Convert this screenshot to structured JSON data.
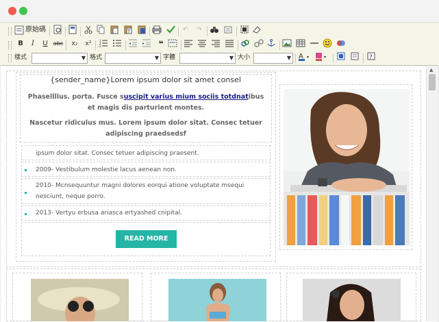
{
  "window": {
    "controls": [
      "close",
      "minimize"
    ],
    "colors": {
      "close": "#ee5c53",
      "minimize": "#3fc64c"
    }
  },
  "toolbar": {
    "source_label": "原始碼",
    "style_label": "樣式",
    "format_label": "格式",
    "font_label": "字體",
    "size_label": "大小",
    "style_value": "",
    "format_value": "",
    "font_value": "",
    "size_value": ""
  },
  "email": {
    "sender_line": "{sender_name}Lorem ipsum dolor sit amet consel",
    "para1_start": "Phasellllus. porta. Fusce s",
    "para1_link": "uscipit varius mium sociis totdnat",
    "para1_end": "ibus et magis dis parturient montes.",
    "para2": "Nascetur ridiculus mus. Lorem ipsum dolor sitat. Consec tetuer adipiscing praedsedsf",
    "list": [
      "ipsum dolor sitat. Consec tetuer adipiscing praesent.",
      "2009- Vestibulum molestie lacus aenean non.",
      "2010- Mcnsequuntur magni dolores eorqui atione voluptate msequi nesciunt, neque porro.",
      "2013- Vertyu erbusa ariasca ertyashed cnipital."
    ],
    "button_label": "READ MORE"
  },
  "colors": {
    "accent": "#23b5a5",
    "link": "#1a1a8c",
    "toolbar_bg": "#f4f5e6"
  }
}
